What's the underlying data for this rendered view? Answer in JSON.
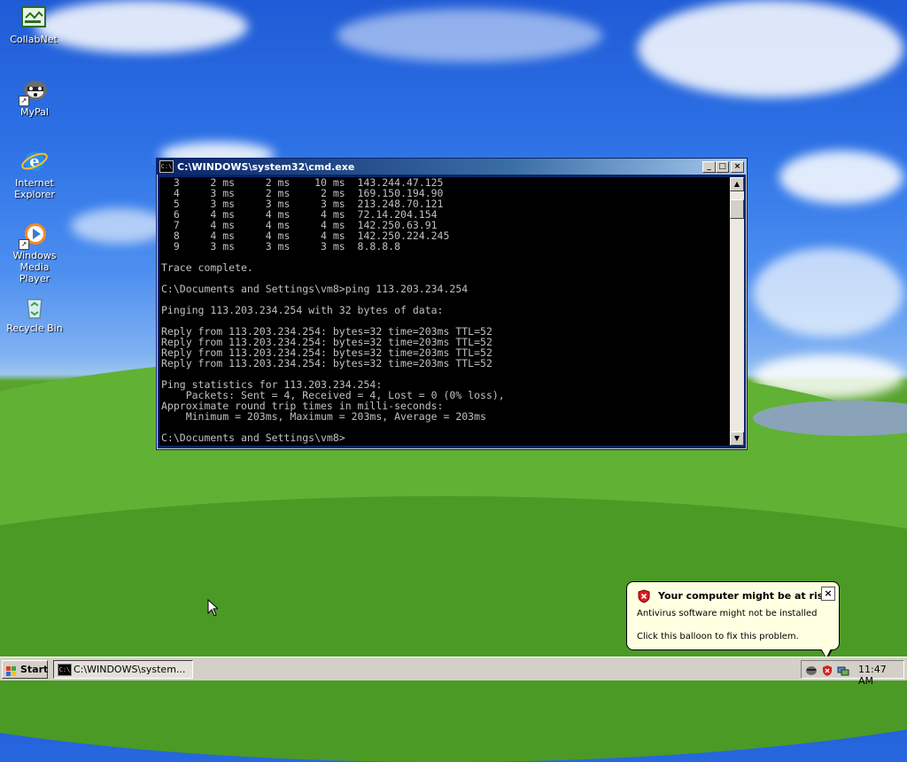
{
  "desktop": {
    "icons": [
      {
        "label": "CollabNet",
        "icon": "collabnet-icon"
      },
      {
        "label": "MyPal",
        "icon": "mypal-icon"
      },
      {
        "label": "Internet\nExplorer",
        "icon": "internet-explorer-icon"
      },
      {
        "label": "Windows Media\nPlayer",
        "icon": "windows-media-player-icon"
      },
      {
        "label": "Recycle Bin",
        "icon": "recycle-bin-icon"
      }
    ]
  },
  "cmd_window": {
    "title": "C:\\WINDOWS\\system32\\cmd.exe",
    "icon_text": "C:\\",
    "buttons": {
      "minimize": "_",
      "maximize": "□",
      "close": "×"
    },
    "console_lines": [
      "  3     2 ms     2 ms    10 ms  143.244.47.125",
      "  4     3 ms     2 ms     2 ms  169.150.194.90",
      "  5     3 ms     3 ms     3 ms  213.248.70.121",
      "  6     4 ms     4 ms     4 ms  72.14.204.154",
      "  7     4 ms     4 ms     4 ms  142.250.63.91",
      "  8     4 ms     4 ms     4 ms  142.250.224.245",
      "  9     3 ms     3 ms     3 ms  8.8.8.8",
      "",
      "Trace complete.",
      "",
      "C:\\Documents and Settings\\vm8>ping 113.203.234.254",
      "",
      "Pinging 113.203.234.254 with 32 bytes of data:",
      "",
      "Reply from 113.203.234.254: bytes=32 time=203ms TTL=52",
      "Reply from 113.203.234.254: bytes=32 time=203ms TTL=52",
      "Reply from 113.203.234.254: bytes=32 time=203ms TTL=52",
      "Reply from 113.203.234.254: bytes=32 time=203ms TTL=52",
      "",
      "Ping statistics for 113.203.234.254:",
      "    Packets: Sent = 4, Received = 4, Lost = 0 (0% loss),",
      "Approximate round trip times in milli-seconds:",
      "    Minimum = 203ms, Maximum = 203ms, Average = 203ms",
      "",
      "C:\\Documents and Settings\\vm8>"
    ]
  },
  "balloon": {
    "title": "Your computer might be at risk",
    "line1": "Antivirus software might not be installed",
    "line2": "Click this balloon to fix this problem.",
    "close": "×"
  },
  "taskbar": {
    "start_label": "Start",
    "task_label": "C:\\WINDOWS\\system...",
    "clock": "11:47 AM"
  },
  "colors": {
    "title_active": "#0a246a",
    "console_bg": "#000000",
    "console_fg": "#c0c0c0",
    "balloon_bg": "#ffffe1",
    "taskbar": "#d4d0c8"
  }
}
